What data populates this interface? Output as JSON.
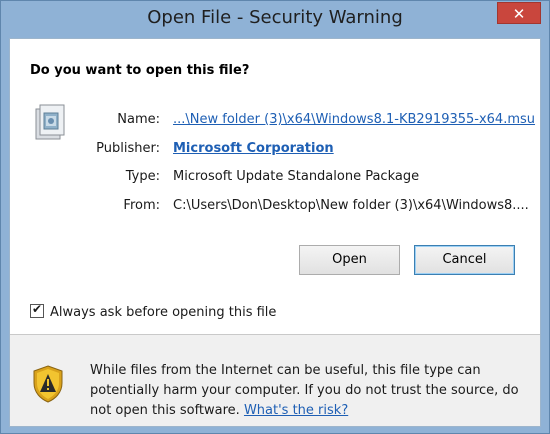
{
  "window": {
    "title": "Open File - Security Warning",
    "close_label": "✕"
  },
  "dialog": {
    "question": "Do you want to open this file?",
    "fields": {
      "name_label": "Name:",
      "name_value": "...\\New folder (3)\\x64\\Windows8.1-KB2919355-x64.msu",
      "publisher_label": "Publisher:",
      "publisher_value": "Microsoft Corporation",
      "type_label": "Type:",
      "type_value": "Microsoft Update Standalone Package",
      "from_label": "From:",
      "from_value": "C:\\Users\\Don\\Desktop\\New folder (3)\\x64\\Windows8...."
    },
    "buttons": {
      "open_label": "Open",
      "cancel_label": "Cancel"
    },
    "checkbox": {
      "label": "Always ask before opening this file",
      "checked": true
    },
    "warning": {
      "text": "While files from the Internet can be useful, this file type can potentially harm your computer. If you do not trust the source, do not open this software. ",
      "link": "What's the risk?"
    }
  },
  "icons": {
    "package": "package-icon",
    "shield": "warning-shield-icon"
  },
  "colors": {
    "link": "#1e5fb4",
    "close": "#c9463d",
    "frame": "#8fb2d6"
  }
}
